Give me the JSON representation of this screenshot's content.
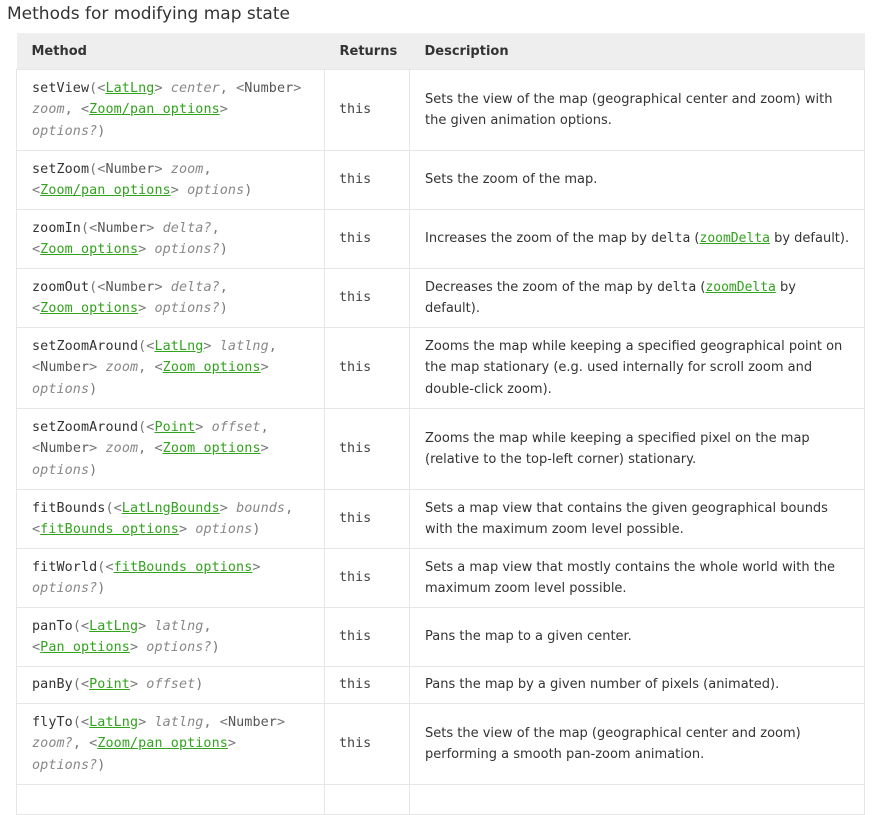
{
  "section_title": "Methods for modifying map state",
  "headers": {
    "method": "Method",
    "returns": "Returns",
    "description": "Description"
  },
  "rows": [
    {
      "returns": "this",
      "desc": "Sets the view of the map (geographical center and zoom) with the given animation options."
    },
    {
      "returns": "this",
      "desc": "Sets the zoom of the map."
    },
    {
      "returns": "this",
      "desc_pre": "Increases the zoom of the map by ",
      "desc_code": "delta",
      "desc_mid": " (",
      "desc_link": "zoomDelta",
      "desc_post": " by default)."
    },
    {
      "returns": "this",
      "desc_pre": "Decreases the zoom of the map by ",
      "desc_code": "delta",
      "desc_mid": " (",
      "desc_link": "zoomDelta",
      "desc_post": " by default)."
    },
    {
      "returns": "this",
      "desc": "Zooms the map while keeping a specified geographical point on the map stationary (e.g. used internally for scroll zoom and double-click zoom)."
    },
    {
      "returns": "this",
      "desc": "Zooms the map while keeping a specified pixel on the map (relative to the top-left corner) stationary."
    },
    {
      "returns": "this",
      "desc": "Sets a map view that contains the given geographical bounds with the maximum zoom level possible."
    },
    {
      "returns": "this",
      "desc": "Sets a map view that mostly contains the whole world with the maximum zoom level possible."
    },
    {
      "returns": "this",
      "desc": "Pans the map to a given center."
    },
    {
      "returns": "this",
      "desc": "Pans the map by a given number of pixels (animated)."
    },
    {
      "returns": "this",
      "desc": "Sets the view of the map (geographical center and zoom) performing a smooth pan-zoom animation."
    }
  ],
  "methods": {
    "setView": {
      "name": "setView",
      "t1": "LatLng",
      "a1": "center",
      "t2": "Number",
      "a2": "zoom",
      "t3": "Zoom/pan options",
      "a3": "options?"
    },
    "setZoom": {
      "name": "setZoom",
      "t1": "Number",
      "a1": "zoom",
      "t2": "Zoom/pan options",
      "a2": "options"
    },
    "zoomIn": {
      "name": "zoomIn",
      "t1": "Number",
      "a1": "delta?",
      "t2": "Zoom options",
      "a2": "options?"
    },
    "zoomOut": {
      "name": "zoomOut",
      "t1": "Number",
      "a1": "delta?",
      "t2": "Zoom options",
      "a2": "options?"
    },
    "setZoomAround1": {
      "name": "setZoomAround",
      "t1": "LatLng",
      "a1": "latlng",
      "t2": "Number",
      "a2": "zoom",
      "t3": "Zoom options",
      "a3": "options"
    },
    "setZoomAround2": {
      "name": "setZoomAround",
      "t1": "Point",
      "a1": "offset",
      "t2": "Number",
      "a2": "zoom",
      "t3": "Zoom options",
      "a3": "options"
    },
    "fitBounds": {
      "name": "fitBounds",
      "t1": "LatLngBounds",
      "a1": "bounds",
      "t2": "fitBounds options",
      "a2": "options"
    },
    "fitWorld": {
      "name": "fitWorld",
      "t1": "fitBounds options",
      "a1": "options?"
    },
    "panTo": {
      "name": "panTo",
      "t1": "LatLng",
      "a1": "latlng",
      "t2": "Pan options",
      "a2": "options?"
    },
    "panBy": {
      "name": "panBy",
      "t1": "Point",
      "a1": "offset"
    },
    "flyTo": {
      "name": "flyTo",
      "t1": "LatLng",
      "a1": "latlng",
      "t2": "Number",
      "a2": "zoom?",
      "t3": "Zoom/pan options",
      "a3": "options?"
    }
  }
}
